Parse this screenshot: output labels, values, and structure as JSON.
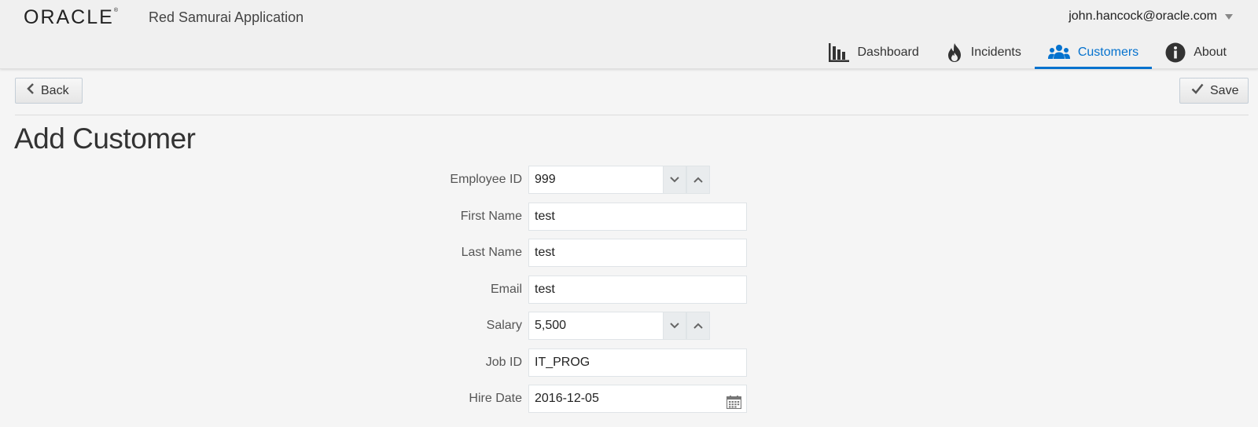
{
  "header": {
    "logo": "ORACLE",
    "logo_mark": "®",
    "app_name": "Red Samurai Application",
    "user": "john.hancock@oracle.com"
  },
  "nav": {
    "items": [
      {
        "label": "Dashboard",
        "icon": "bar-chart-icon"
      },
      {
        "label": "Incidents",
        "icon": "fire-icon"
      },
      {
        "label": "Customers",
        "icon": "people-icon",
        "active": true
      },
      {
        "label": "About",
        "icon": "info-icon"
      }
    ]
  },
  "toolbar": {
    "back_label": "Back",
    "save_label": "Save"
  },
  "page": {
    "title": "Add Customer"
  },
  "form": {
    "employee_id": {
      "label": "Employee ID",
      "value": "999"
    },
    "first_name": {
      "label": "First Name",
      "value": "test"
    },
    "last_name": {
      "label": "Last Name",
      "value": "test"
    },
    "email": {
      "label": "Email",
      "value": "test"
    },
    "salary": {
      "label": "Salary",
      "value": "5,500"
    },
    "job_id": {
      "label": "Job ID",
      "value": "IT_PROG"
    },
    "hire_date": {
      "label": "Hire Date",
      "value": "2016-12-05"
    }
  },
  "colors": {
    "accent": "#0572ce",
    "background": "#f5f5f5",
    "header_bg": "#f0f0f0"
  }
}
